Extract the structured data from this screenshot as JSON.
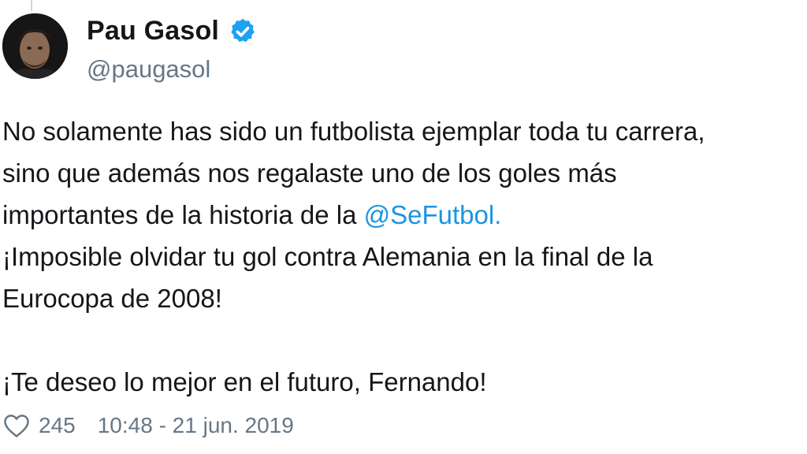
{
  "user": {
    "display_name": "Pau Gasol",
    "handle": "@paugasol",
    "verified": true,
    "avatar_icon": "profile-photo"
  },
  "tweet": {
    "lines": [
      "No solamente has sido un futbolista ejemplar toda tu carrera,",
      "sino que además nos regalaste uno de los goles más",
      "importantes de la historia de la "
    ],
    "mention": "@SeFutbol",
    "mention_tail": ".",
    "lines_after": [
      "¡Imposible olvidar tu gol contra Alemania en la final de la",
      "Eurocopa de 2008!"
    ],
    "closing": "¡Te deseo lo mejor en el futuro, Fernando!"
  },
  "footer": {
    "like_icon": "heart-icon",
    "likes": "245",
    "timestamp": "10:48 - 21 jun. 2019"
  },
  "colors": {
    "mention": "#1b95e0",
    "verified": "#1da1f2",
    "muted": "#657786",
    "text": "#14171a"
  }
}
